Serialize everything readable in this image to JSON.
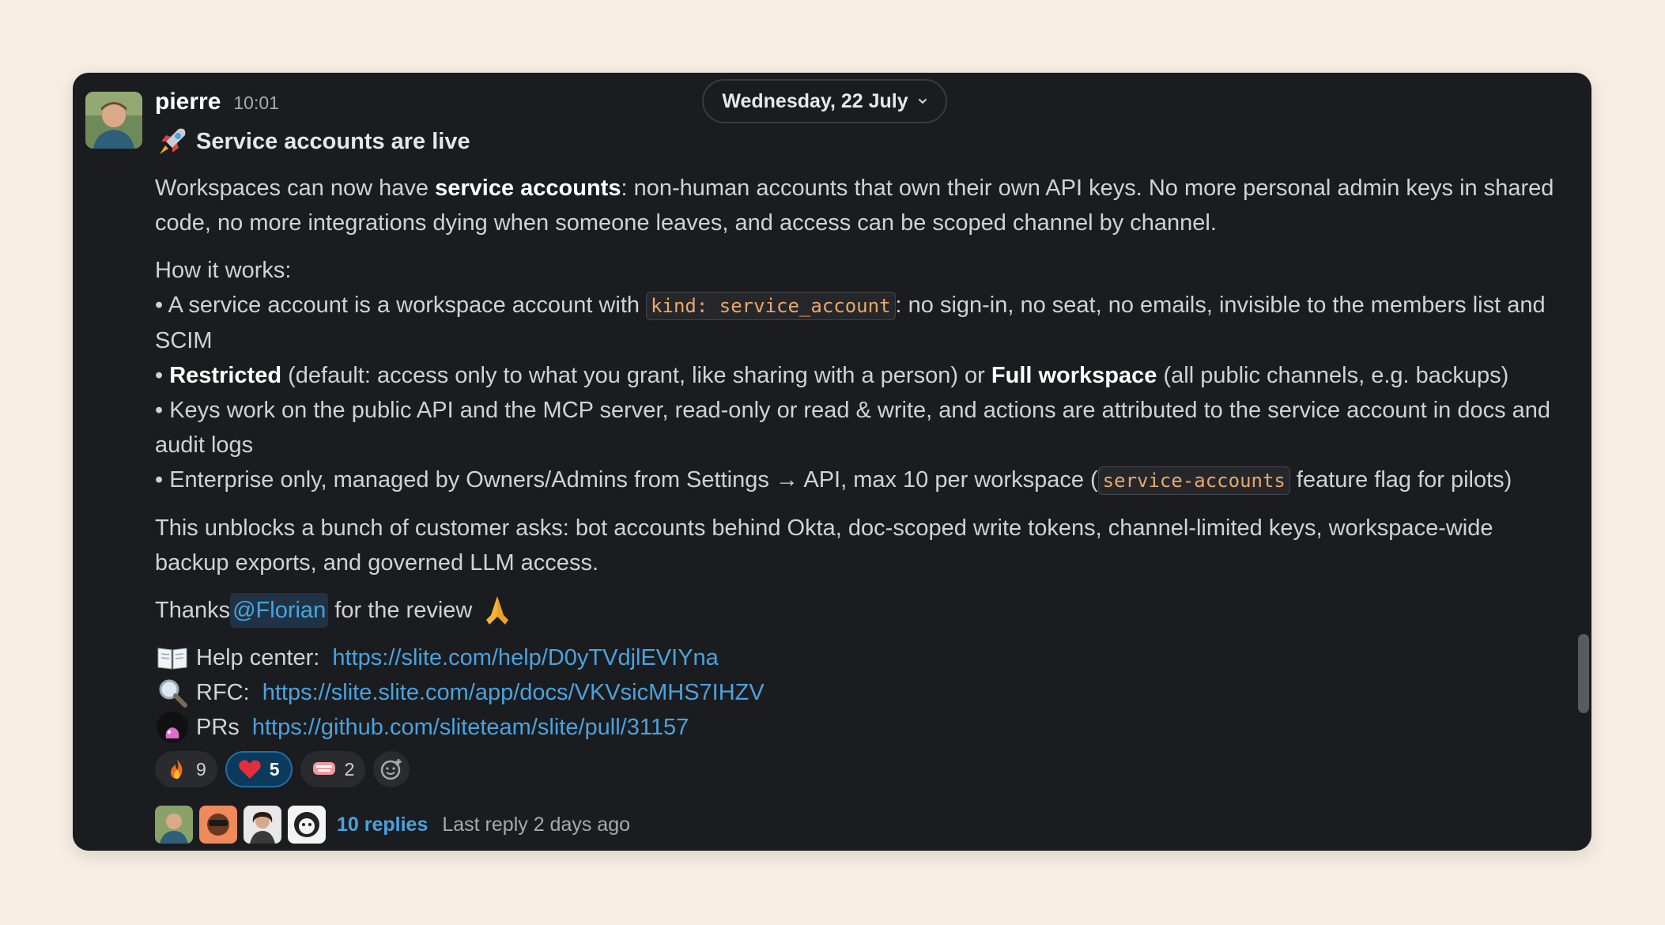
{
  "date_pill": {
    "label": "Wednesday, 22 July",
    "icon": "chevron-down-icon"
  },
  "message": {
    "author": "pierre",
    "time": "10:01",
    "title_emoji": "rocket-icon",
    "title": "Service accounts are live",
    "p1": {
      "a": "Workspaces can now have ",
      "b": "service accounts",
      "c": ": non-human accounts that own their own API keys. No more personal admin keys in shared code, no more integrations dying when someone leaves, and access can be scoped channel by channel."
    },
    "how_it_works": "How it works:",
    "bullet1": {
      "a": "• A service account is a workspace account with ",
      "code": "kind: service_account",
      "b": ": no sign-in, no seat, no emails, invisible to the members list and SCIM"
    },
    "bullet2": {
      "a": "• ",
      "b": "Restricted",
      "c": " (default: access only to what you grant, like sharing with a person) or ",
      "d": "Full workspace",
      "e": " (all public channels, e.g. backups)"
    },
    "bullet3": "• Keys work on the public API and the MCP server, read-only or read & write, and actions are attributed to the service account in docs and audit logs",
    "bullet4": {
      "a": "• Enterprise only, managed by Owners/Admins from Settings → API, max 10 per workspace (",
      "code": "service-accounts",
      "b": " feature flag for pilots)"
    },
    "p3": "This unblocks a bunch of customer asks: bot accounts behind Okta, doc-scoped write tokens, channel-limited keys, workspace-wide backup exports, and governed LLM access.",
    "thanks": {
      "a": "Thanks ",
      "mention": "@Florian",
      "b": " for the review",
      "emoji": "pray-icon"
    },
    "links": [
      {
        "icon": "book-icon",
        "label": "Help center: ",
        "url": "https://slite.com/help/D0yTVdjlEVIYna"
      },
      {
        "icon": "magnifier-icon",
        "label": "RFC: ",
        "url": "https://slite.slite.com/app/docs/VKVsicMHS7IHZV"
      },
      {
        "icon": "octocat-icon",
        "label": "PRs ",
        "url": "https://github.com/sliteteam/slite/pull/31157"
      }
    ]
  },
  "reactions": [
    {
      "icon": "fire-icon",
      "count": "9"
    },
    {
      "icon": "heart-icon",
      "count": "5"
    },
    {
      "icon": "thank-you-icon",
      "count": "2"
    }
  ],
  "thread": {
    "replies": "10 replies",
    "last_reply": "Last reply 2 days ago"
  }
}
